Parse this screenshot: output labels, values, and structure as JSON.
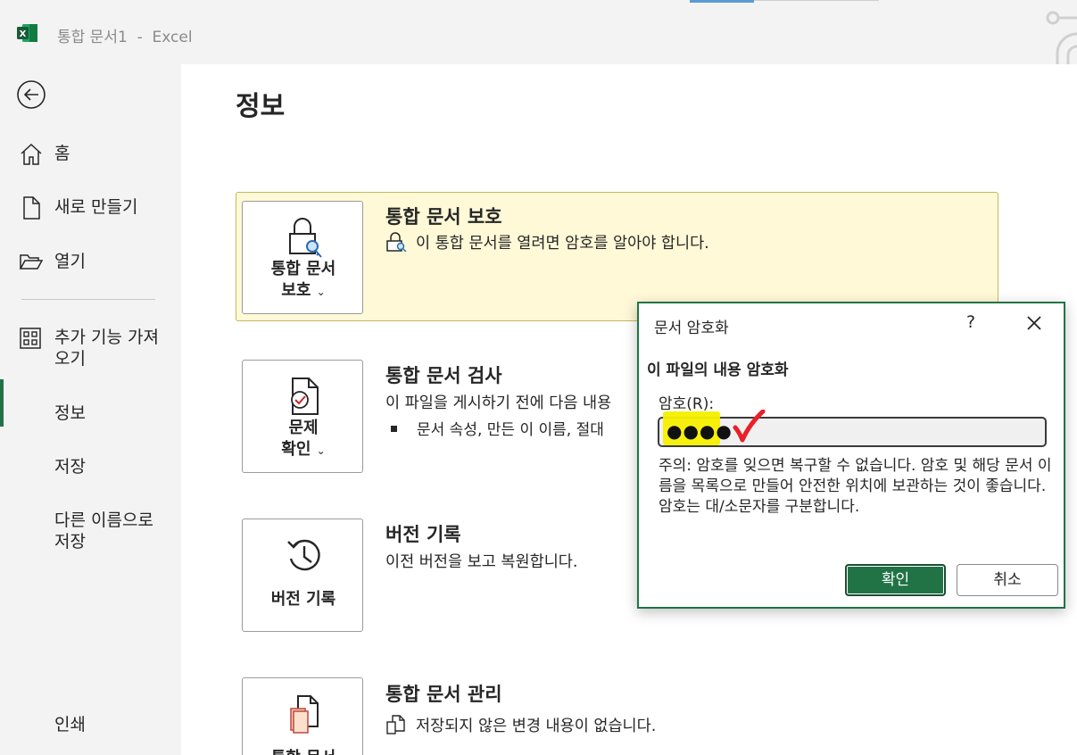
{
  "window": {
    "title": "통합 문서1  -  Excel"
  },
  "nav": {
    "items": [
      {
        "label": "홈",
        "icon": "home-icon"
      },
      {
        "label": "새로 만들기",
        "icon": "new-file-icon"
      },
      {
        "label": "열기",
        "icon": "open-folder-icon"
      },
      {
        "label": "추가 기능 가져오기",
        "icon": "add-ins-icon"
      },
      {
        "label": "정보"
      },
      {
        "label": "저장"
      },
      {
        "label": "다른 이름으로 저장"
      },
      {
        "label": "인쇄"
      }
    ],
    "active": "정보",
    "accent_color": "#217346"
  },
  "main": {
    "title": "정보",
    "sections": [
      {
        "tile_label_1": "통합 문서",
        "tile_label_2": "보호",
        "title": "통합 문서 보호",
        "desc": "이 통합 문서를 열려면 암호를 알아야 합니다.",
        "highlight_color": "#fff9d7"
      },
      {
        "tile_label_1": "문제",
        "tile_label_2": "확인",
        "title": "통합 문서 검사",
        "desc": "이 파일을 게시하기 전에 다음 내용",
        "bullet": "문서 속성, 만든 이 이름, 절대"
      },
      {
        "tile_label": "버전 기록",
        "title": "버전 기록",
        "desc": "이전 버전을 보고 복원합니다."
      },
      {
        "tile_label": "통합 문서",
        "title": "통합 문서 관리",
        "desc": "저장되지 않은 변경 내용이 없습니다."
      }
    ]
  },
  "dialog": {
    "title": "문서 암호화",
    "help": "?",
    "heading": "이 파일의 내용 암호화",
    "password_label": "암호(R):",
    "password_mask": "●●●●",
    "warning_1": "주의: 암호를 잊으면 복구할 수 없습니다. 암호 및 해당 문서 이름을 목록으로 만들어 안전한 위치에 보관하는 것이 좋습니다.",
    "warning_2": "암호는 대/소문자를 구분합니다.",
    "ok_label": "확인",
    "cancel_label": "취소",
    "annotation_highlight_color": "#f4f000",
    "annotation_check_color": "#e8202a"
  }
}
